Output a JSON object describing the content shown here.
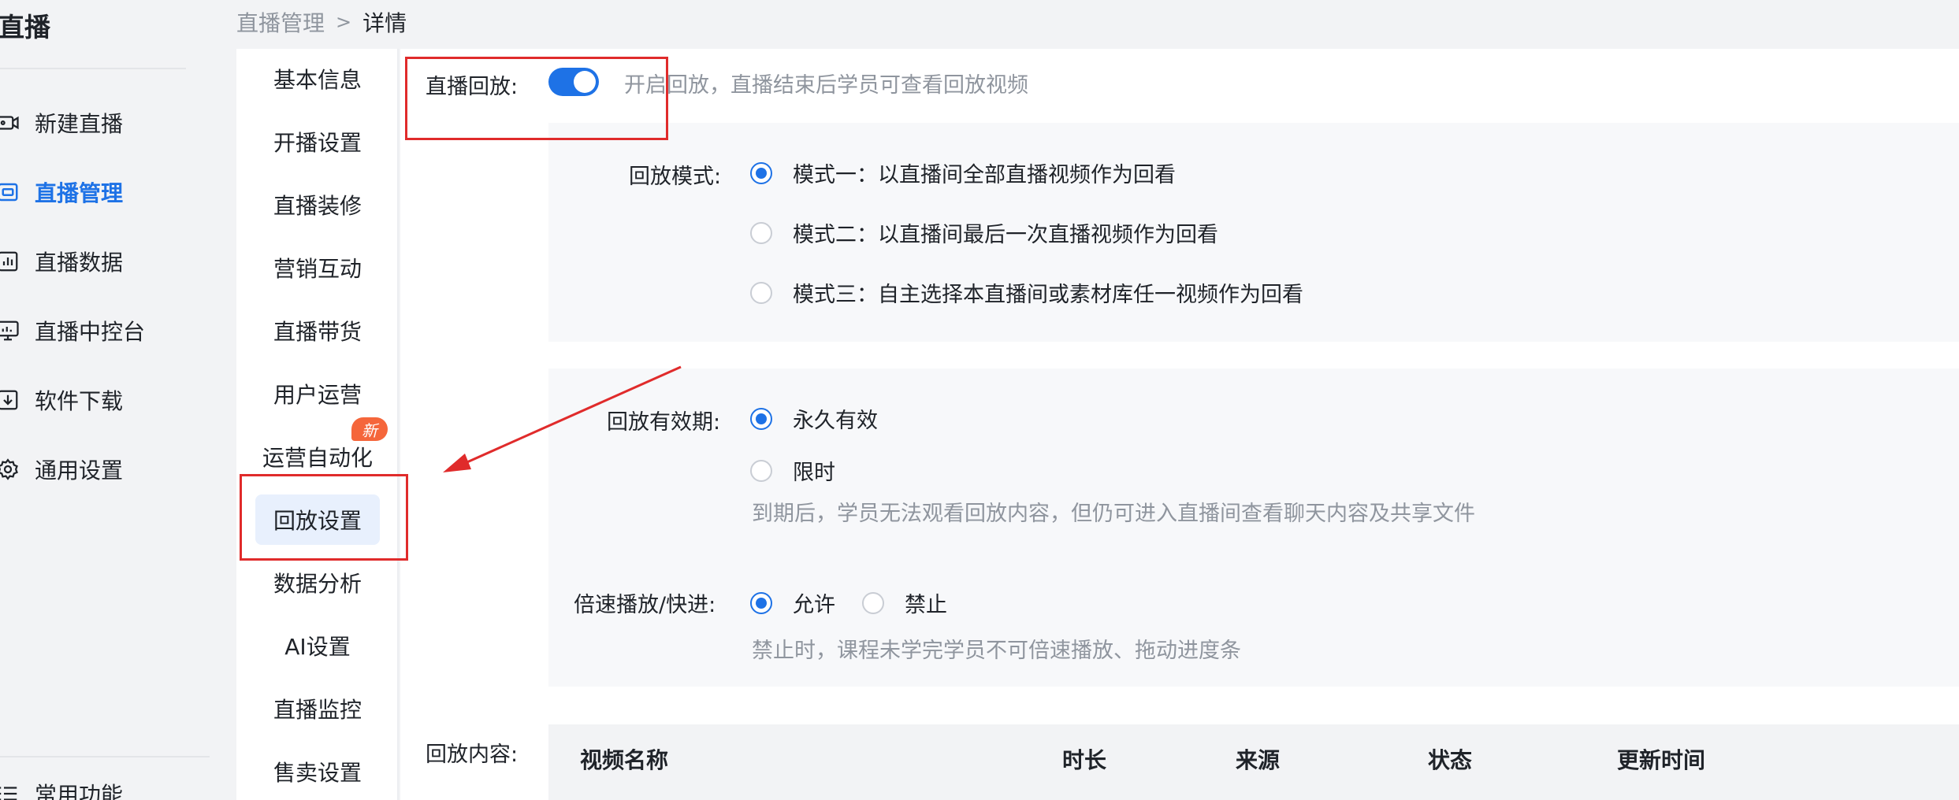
{
  "app": {
    "title": "直播"
  },
  "nav": {
    "items": [
      {
        "label": "新建直播",
        "icon": "video-camera-icon"
      },
      {
        "label": "直播管理",
        "icon": "live-screen-icon",
        "active": true
      },
      {
        "label": "直播数据",
        "icon": "bar-chart-icon"
      },
      {
        "label": "直播中控台",
        "icon": "monitor-icon"
      },
      {
        "label": "软件下载",
        "icon": "download-icon"
      },
      {
        "label": "通用设置",
        "icon": "gear-icon"
      }
    ],
    "bottom_item": {
      "label": "常用功能",
      "icon": "list-icon"
    }
  },
  "breadcrumb": {
    "parent": "直播管理",
    "separator": ">",
    "current": "详情"
  },
  "sub_menu": {
    "items": [
      "基本信息",
      "开播设置",
      "直播装修",
      "营销互动",
      "直播带货",
      "用户运营",
      "运营自动化",
      "回放设置",
      "数据分析",
      "AI设置",
      "直播监控",
      "售卖设置"
    ],
    "active_index": 7,
    "badge_new": "新"
  },
  "replay": {
    "label": "直播回放:",
    "enabled": true,
    "hint": "开启回放，直播结束后学员可查看回放视频"
  },
  "mode": {
    "label": "回放模式:",
    "options": [
      {
        "label": "模式一：以直播间全部直播视频作为回看",
        "selected": true
      },
      {
        "label": "模式二：以直播间最后一次直播视频作为回看",
        "selected": false
      },
      {
        "label": "模式三：自主选择本直播间或素材库任一视频作为回看",
        "selected": false
      }
    ]
  },
  "validity": {
    "label": "回放有效期:",
    "options": [
      {
        "label": "永久有效",
        "selected": true
      },
      {
        "label": "限时",
        "selected": false
      }
    ],
    "hint": "到期后，学员无法观看回放内容，但仍可进入直播间查看聊天内容及共享文件"
  },
  "speed": {
    "label": "倍速播放/快进:",
    "options": [
      {
        "label": "允许",
        "selected": true
      },
      {
        "label": "禁止",
        "selected": false
      }
    ],
    "hint": "禁止时，课程未学完学员不可倍速播放、拖动进度条"
  },
  "content": {
    "label": "回放内容:",
    "columns": [
      "视频名称",
      "时长",
      "来源",
      "状态",
      "更新时间"
    ]
  },
  "colors": {
    "accent": "#1e72e6",
    "annotation": "#e02b2b",
    "badge": "#f5663b"
  }
}
